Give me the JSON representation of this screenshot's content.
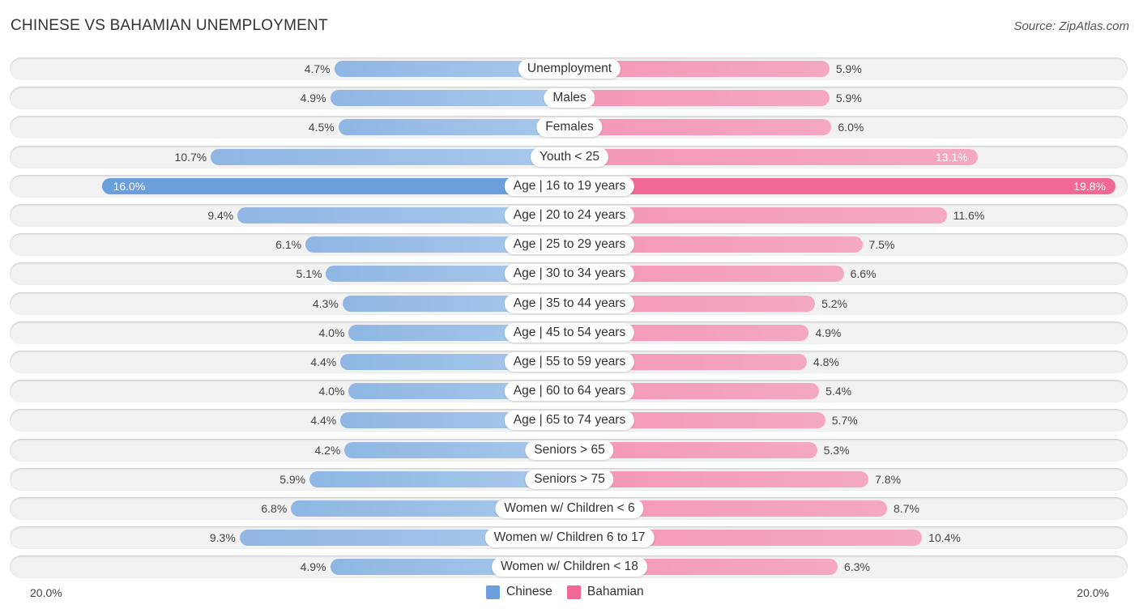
{
  "chart_data": {
    "type": "bar",
    "orientation": "horizontal-diverging",
    "title": "CHINESE VS BAHAMIAN UNEMPLOYMENT",
    "source": "Source: ZipAtlas.com",
    "categories": [
      "Unemployment",
      "Males",
      "Females",
      "Youth < 25",
      "Age | 16 to 19 years",
      "Age | 20 to 24 years",
      "Age | 25 to 29 years",
      "Age | 30 to 34 years",
      "Age | 35 to 44 years",
      "Age | 45 to 54 years",
      "Age | 55 to 59 years",
      "Age | 60 to 64 years",
      "Age | 65 to 74 years",
      "Seniors > 65",
      "Seniors > 75",
      "Women w/ Children < 6",
      "Women w/ Children 6 to 17",
      "Women w/ Children < 18"
    ],
    "series": [
      {
        "name": "Chinese",
        "color": "#6a9fdc",
        "values": [
          4.7,
          4.9,
          4.5,
          10.7,
          16.0,
          9.4,
          6.1,
          5.1,
          4.3,
          4.0,
          4.4,
          4.0,
          4.4,
          4.2,
          5.9,
          6.8,
          9.3,
          4.9
        ]
      },
      {
        "name": "Bahamian",
        "color": "#f06893",
        "values": [
          5.9,
          5.9,
          6.0,
          13.1,
          19.8,
          11.6,
          7.5,
          6.6,
          5.2,
          4.9,
          4.8,
          5.4,
          5.7,
          5.3,
          7.8,
          8.7,
          10.4,
          6.3
        ]
      }
    ],
    "value_suffix": "%",
    "axis": {
      "left_label": "20.0%",
      "right_label": "20.0%",
      "xlim": [
        0,
        20
      ]
    },
    "legend": {
      "position": "bottom-center",
      "items": [
        "Chinese",
        "Bahamian"
      ]
    },
    "grid": false
  }
}
